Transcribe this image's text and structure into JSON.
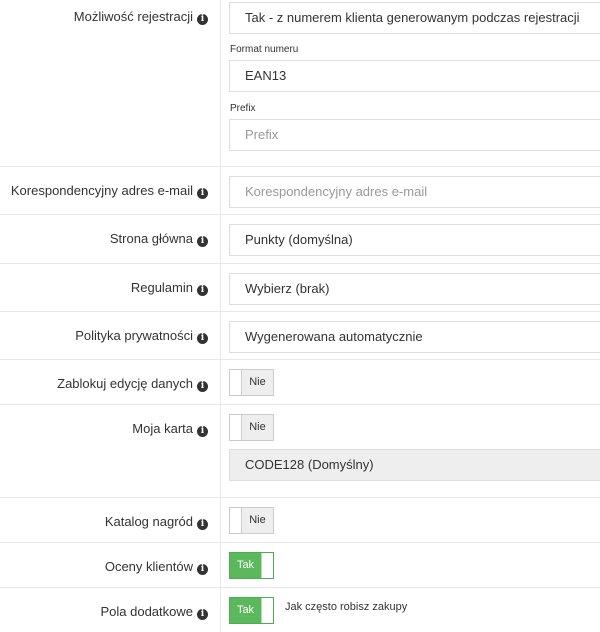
{
  "registration": {
    "label": "Możliwość rejestracji",
    "value": "Tak - z numerem klienta generowanym podczas rejestracji",
    "format": {
      "label": "Format numeru",
      "value": "EAN13"
    },
    "prefix": {
      "label": "Prefix",
      "placeholder": "Prefix"
    }
  },
  "email": {
    "label": "Korespondencyjny adres e-mail",
    "placeholder": "Korespondencyjny adres e-mail"
  },
  "homepage": {
    "label": "Strona główna",
    "value": "Punkty (domyślna)"
  },
  "terms": {
    "label": "Regulamin",
    "value": "Wybierz (brak)"
  },
  "privacy": {
    "label": "Polityka prywatności",
    "value": "Wygenerowana automatycznie"
  },
  "lock_edit": {
    "label": "Zablokuj edycję danych",
    "toggle": "Nie"
  },
  "my_card": {
    "label": "Moja karta",
    "toggle": "Nie",
    "barcode": "CODE128 (Domyślny)"
  },
  "rewards": {
    "label": "Katalog nagród",
    "toggle": "Nie"
  },
  "ratings": {
    "label": "Oceny klientów",
    "toggle": "Tak"
  },
  "extra_fields": {
    "label": "Pola dodatkowe",
    "toggle": "Tak",
    "question": "Jak często robisz zakupy"
  }
}
